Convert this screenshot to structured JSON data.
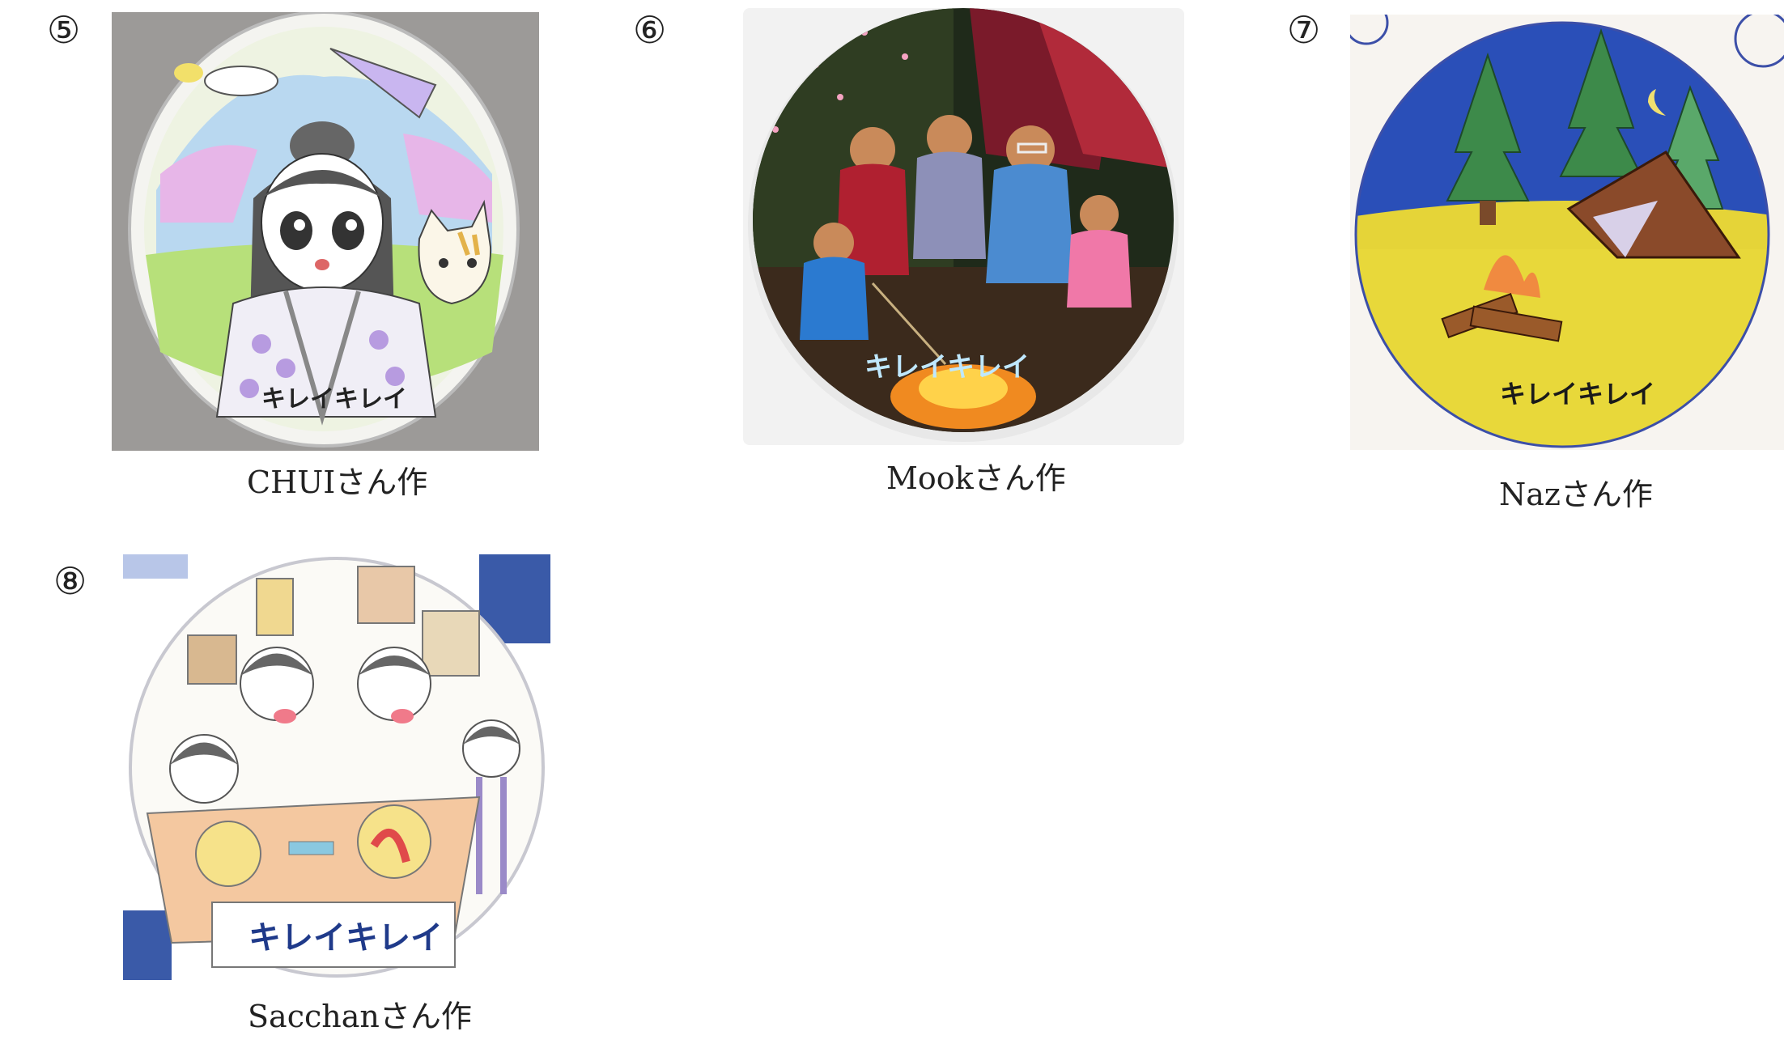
{
  "entries": [
    {
      "number": "⑤",
      "caption": "CHUIさん作",
      "stamp": "キレイキレイ"
    },
    {
      "number": "⑥",
      "caption": "Mookさん作",
      "stamp": "キレイキレイ"
    },
    {
      "number": "⑦",
      "caption": "Nazさん作",
      "stamp": "キレイキレイ"
    },
    {
      "number": "⑧",
      "caption": "Sacchanさん作",
      "stamp": "キレイキレイ"
    }
  ],
  "artwork_descriptions": [
    "girl-in-kimono-with-cat",
    "family-campfire-in-forest",
    "tent-and-campfire-at-night",
    "family-at-dinner-table"
  ]
}
